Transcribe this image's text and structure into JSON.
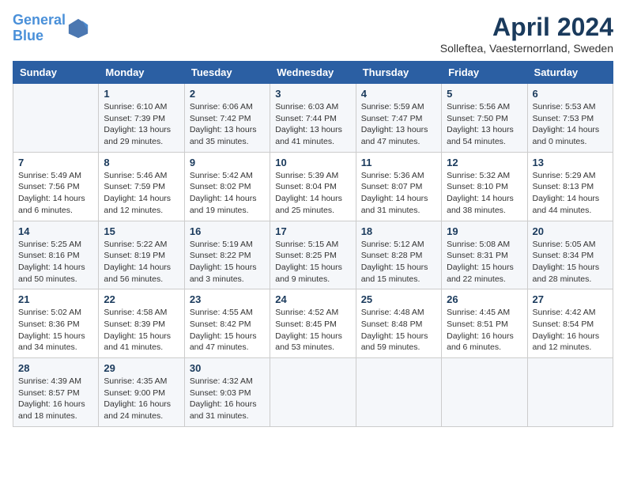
{
  "header": {
    "logo_line1": "General",
    "logo_line2": "Blue",
    "month_title": "April 2024",
    "subtitle": "Solleftea, Vaesternorrland, Sweden"
  },
  "days_of_week": [
    "Sunday",
    "Monday",
    "Tuesday",
    "Wednesday",
    "Thursday",
    "Friday",
    "Saturday"
  ],
  "weeks": [
    [
      {
        "day": "",
        "detail": ""
      },
      {
        "day": "1",
        "detail": "Sunrise: 6:10 AM\nSunset: 7:39 PM\nDaylight: 13 hours\nand 29 minutes."
      },
      {
        "day": "2",
        "detail": "Sunrise: 6:06 AM\nSunset: 7:42 PM\nDaylight: 13 hours\nand 35 minutes."
      },
      {
        "day": "3",
        "detail": "Sunrise: 6:03 AM\nSunset: 7:44 PM\nDaylight: 13 hours\nand 41 minutes."
      },
      {
        "day": "4",
        "detail": "Sunrise: 5:59 AM\nSunset: 7:47 PM\nDaylight: 13 hours\nand 47 minutes."
      },
      {
        "day": "5",
        "detail": "Sunrise: 5:56 AM\nSunset: 7:50 PM\nDaylight: 13 hours\nand 54 minutes."
      },
      {
        "day": "6",
        "detail": "Sunrise: 5:53 AM\nSunset: 7:53 PM\nDaylight: 14 hours\nand 0 minutes."
      }
    ],
    [
      {
        "day": "7",
        "detail": "Sunrise: 5:49 AM\nSunset: 7:56 PM\nDaylight: 14 hours\nand 6 minutes."
      },
      {
        "day": "8",
        "detail": "Sunrise: 5:46 AM\nSunset: 7:59 PM\nDaylight: 14 hours\nand 12 minutes."
      },
      {
        "day": "9",
        "detail": "Sunrise: 5:42 AM\nSunset: 8:02 PM\nDaylight: 14 hours\nand 19 minutes."
      },
      {
        "day": "10",
        "detail": "Sunrise: 5:39 AM\nSunset: 8:04 PM\nDaylight: 14 hours\nand 25 minutes."
      },
      {
        "day": "11",
        "detail": "Sunrise: 5:36 AM\nSunset: 8:07 PM\nDaylight: 14 hours\nand 31 minutes."
      },
      {
        "day": "12",
        "detail": "Sunrise: 5:32 AM\nSunset: 8:10 PM\nDaylight: 14 hours\nand 38 minutes."
      },
      {
        "day": "13",
        "detail": "Sunrise: 5:29 AM\nSunset: 8:13 PM\nDaylight: 14 hours\nand 44 minutes."
      }
    ],
    [
      {
        "day": "14",
        "detail": "Sunrise: 5:25 AM\nSunset: 8:16 PM\nDaylight: 14 hours\nand 50 minutes."
      },
      {
        "day": "15",
        "detail": "Sunrise: 5:22 AM\nSunset: 8:19 PM\nDaylight: 14 hours\nand 56 minutes."
      },
      {
        "day": "16",
        "detail": "Sunrise: 5:19 AM\nSunset: 8:22 PM\nDaylight: 15 hours\nand 3 minutes."
      },
      {
        "day": "17",
        "detail": "Sunrise: 5:15 AM\nSunset: 8:25 PM\nDaylight: 15 hours\nand 9 minutes."
      },
      {
        "day": "18",
        "detail": "Sunrise: 5:12 AM\nSunset: 8:28 PM\nDaylight: 15 hours\nand 15 minutes."
      },
      {
        "day": "19",
        "detail": "Sunrise: 5:08 AM\nSunset: 8:31 PM\nDaylight: 15 hours\nand 22 minutes."
      },
      {
        "day": "20",
        "detail": "Sunrise: 5:05 AM\nSunset: 8:34 PM\nDaylight: 15 hours\nand 28 minutes."
      }
    ],
    [
      {
        "day": "21",
        "detail": "Sunrise: 5:02 AM\nSunset: 8:36 PM\nDaylight: 15 hours\nand 34 minutes."
      },
      {
        "day": "22",
        "detail": "Sunrise: 4:58 AM\nSunset: 8:39 PM\nDaylight: 15 hours\nand 41 minutes."
      },
      {
        "day": "23",
        "detail": "Sunrise: 4:55 AM\nSunset: 8:42 PM\nDaylight: 15 hours\nand 47 minutes."
      },
      {
        "day": "24",
        "detail": "Sunrise: 4:52 AM\nSunset: 8:45 PM\nDaylight: 15 hours\nand 53 minutes."
      },
      {
        "day": "25",
        "detail": "Sunrise: 4:48 AM\nSunset: 8:48 PM\nDaylight: 15 hours\nand 59 minutes."
      },
      {
        "day": "26",
        "detail": "Sunrise: 4:45 AM\nSunset: 8:51 PM\nDaylight: 16 hours\nand 6 minutes."
      },
      {
        "day": "27",
        "detail": "Sunrise: 4:42 AM\nSunset: 8:54 PM\nDaylight: 16 hours\nand 12 minutes."
      }
    ],
    [
      {
        "day": "28",
        "detail": "Sunrise: 4:39 AM\nSunset: 8:57 PM\nDaylight: 16 hours\nand 18 minutes."
      },
      {
        "day": "29",
        "detail": "Sunrise: 4:35 AM\nSunset: 9:00 PM\nDaylight: 16 hours\nand 24 minutes."
      },
      {
        "day": "30",
        "detail": "Sunrise: 4:32 AM\nSunset: 9:03 PM\nDaylight: 16 hours\nand 31 minutes."
      },
      {
        "day": "",
        "detail": ""
      },
      {
        "day": "",
        "detail": ""
      },
      {
        "day": "",
        "detail": ""
      },
      {
        "day": "",
        "detail": ""
      }
    ]
  ]
}
